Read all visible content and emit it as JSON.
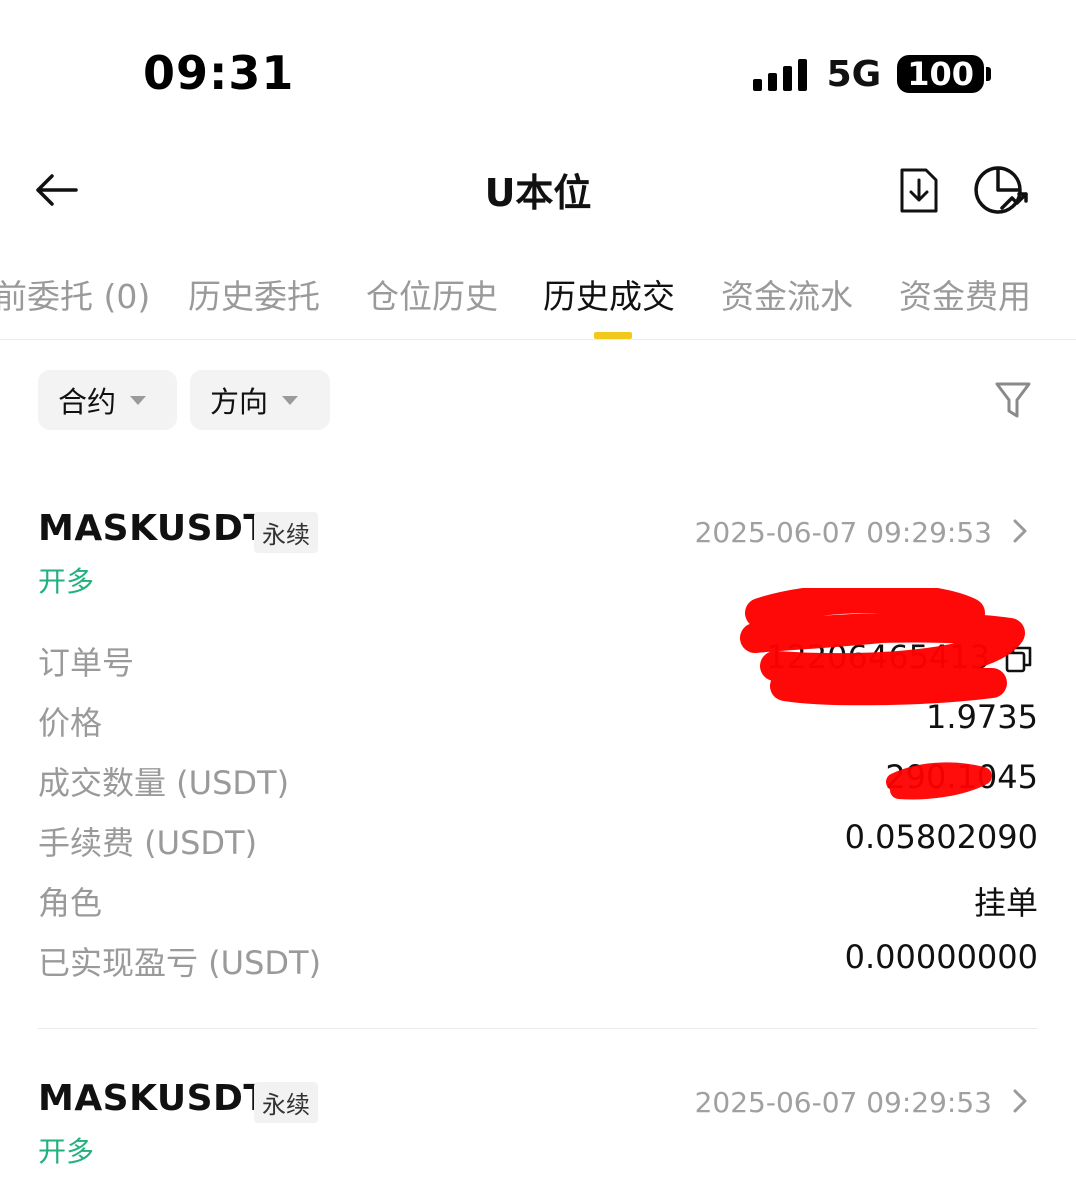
{
  "status_bar": {
    "time": "09:31",
    "network": "5G",
    "battery": "100"
  },
  "nav": {
    "title": "U本位",
    "back_icon": "arrow-left-icon",
    "download_icon": "download-icon",
    "analysis_icon": "pie-chart-icon"
  },
  "tabs": [
    {
      "label": "前委托 (0)"
    },
    {
      "label": "历史委托"
    },
    {
      "label": "仓位历史"
    },
    {
      "label": "历史成交",
      "active": true
    },
    {
      "label": "资金流水"
    },
    {
      "label": "资金费用"
    }
  ],
  "filters": {
    "contract": "合约",
    "direction": "方向",
    "filter_icon": "funnel-icon"
  },
  "colors": {
    "accent": "#f2c81a",
    "long_green": "#22b07d",
    "muted_gray": "#9a9a9a",
    "redaction_red": "#ff0000"
  },
  "records": [
    {
      "symbol": "MASKUSDT",
      "tag": "永续",
      "time": "2025-06-07 09:29:53",
      "side": "开多",
      "fields": {
        "order_id": {
          "label": "订单号",
          "value": "12206465413"
        },
        "price": {
          "label": "价格",
          "value": "1.9735"
        },
        "quantity": {
          "label": "成交数量 (USDT)",
          "value": "290.1045"
        },
        "fee": {
          "label": "手续费 (USDT)",
          "value": "0.05802090"
        },
        "role": {
          "label": "角色",
          "value": "挂单"
        },
        "pnl": {
          "label": "已实现盈亏 (USDT)",
          "value": "0.00000000"
        }
      }
    },
    {
      "symbol": "MASKUSDT",
      "tag": "永续",
      "time": "2025-06-07 09:29:53",
      "side": "开多"
    }
  ]
}
